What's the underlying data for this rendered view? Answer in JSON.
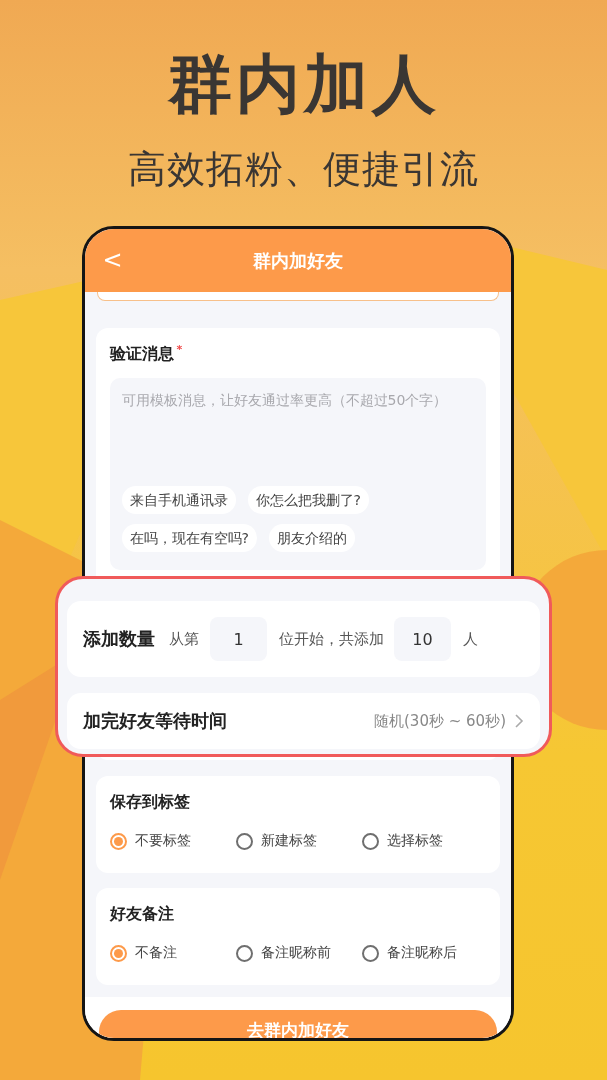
{
  "headline": "群内加人",
  "subtitle": "高效拓粉、便捷引流",
  "screen": {
    "header": {
      "back_icon": "<",
      "title": "群内加好友"
    },
    "message_card": {
      "title": "验证消息",
      "required_mark": "*",
      "placeholder": "可用模板消息，让好友通过率更高（不超过50个字）",
      "templates": [
        "来自手机通讯录",
        "你怎么把我删了?",
        "在吗，现在有空吗?",
        "朋友介绍的"
      ]
    },
    "option_groups": [
      {
        "title": "保存到标签",
        "options": [
          {
            "label": "不要标签",
            "selected": true
          },
          {
            "label": "新建标签",
            "selected": false
          },
          {
            "label": "选择标签",
            "selected": false
          }
        ]
      },
      {
        "title": "好友备注",
        "options": [
          {
            "label": "不备注",
            "selected": true
          },
          {
            "label": "备注昵称前",
            "selected": false
          },
          {
            "label": "备注昵称后",
            "selected": false
          }
        ]
      }
    ],
    "submit_button": "去群内加好友"
  },
  "callout": {
    "count_row": {
      "label": "添加数量",
      "prefix": "从第",
      "start_value": "1",
      "middle": "位开始，共添加",
      "count_value": "10",
      "suffix": "人"
    },
    "wait_row": {
      "label": "加完好友等待时间",
      "value": "随机(30秒 ~ 60秒)"
    }
  }
}
